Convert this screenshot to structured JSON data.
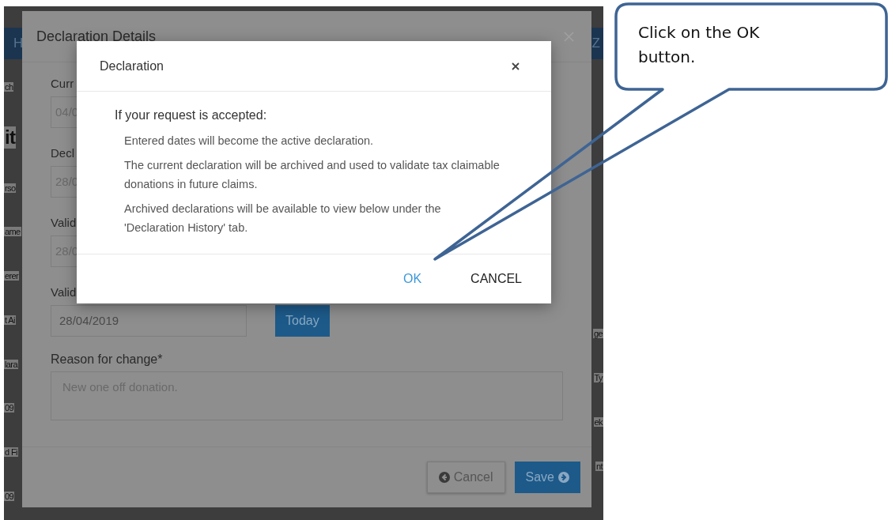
{
  "background_page": {
    "nav_left": "H",
    "nav_right": "Z",
    "left_fragments": [
      "ch",
      "it",
      "rso",
      "ame",
      "erer",
      "t Ai",
      "lara",
      "09",
      "d Fi",
      "09"
    ],
    "right_fragments": [
      "ge",
      "Ty",
      "ek",
      "nt"
    ]
  },
  "details_modal": {
    "title": "Declaration Details",
    "clipped_fields": [
      {
        "label": "Curr",
        "value": "04/0"
      },
      {
        "label": "Decl",
        "value": "28/0"
      },
      {
        "label": "Valid",
        "value": "28/0"
      }
    ],
    "clipped_label": "Valid",
    "date_field": {
      "value": "28/04/2019",
      "button": "Today"
    },
    "reason": {
      "label": "Reason for change*",
      "value": "New one off donation."
    },
    "buttons": [
      {
        "label": "Cancel",
        "kind": "back"
      },
      {
        "label": "Save",
        "kind": "next"
      }
    ]
  },
  "dialog": {
    "title": "Declaration",
    "lead": "If your request is accepted:",
    "points": [
      "Entered dates will become the active declaration.",
      "The current declaration will be archived and used to validate tax claimable donations in future claims.",
      "Archived declarations will be available to view below under the 'Declaration History' tab."
    ],
    "buttons": [
      {
        "label": "OK",
        "kind": "primary"
      },
      {
        "label": "CANCEL",
        "kind": "plain"
      }
    ]
  },
  "callout": {
    "text": "Click on the OK button."
  }
}
